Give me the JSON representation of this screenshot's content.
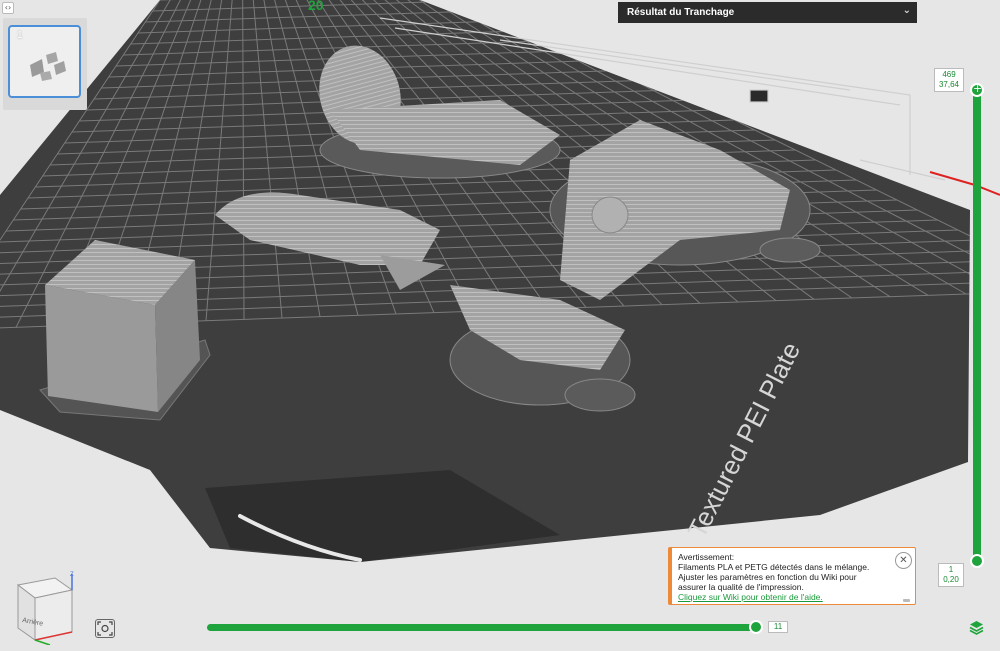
{
  "panel": {
    "title": "Résultat du Tranchage",
    "expand_icon": "double-chevron-down-icon"
  },
  "plates": [
    {
      "number": "1"
    }
  ],
  "layer_slider": {
    "top_layer": "469",
    "top_height": "37,64",
    "bottom_layer": "1",
    "bottom_height": "0,20"
  },
  "move_slider": {
    "value": "11",
    "position_fraction": 1.0
  },
  "warning": {
    "title": "Avertissement:",
    "line1": "Filaments PLA et PETG détectés dans le mélange.",
    "line2": "Ajuster les paramètres en fonction du Wiki pour",
    "line3": "assurer la qualité de l'impression.",
    "link": "Cliquez sur Wiki pour obtenir de l'aide.",
    "close_icon": "close-icon"
  },
  "bed": {
    "plate_label": "Textured PEI Plate",
    "corner_mark": "20"
  },
  "view_cube": {
    "back_label": "Arrière",
    "z_axis": "Z"
  },
  "colors": {
    "accent": "#1fa33c",
    "warning": "#ec8a3a",
    "plate": "#3e3e3e",
    "grid": "#8e8e8e",
    "model": "#a8a8a8"
  }
}
